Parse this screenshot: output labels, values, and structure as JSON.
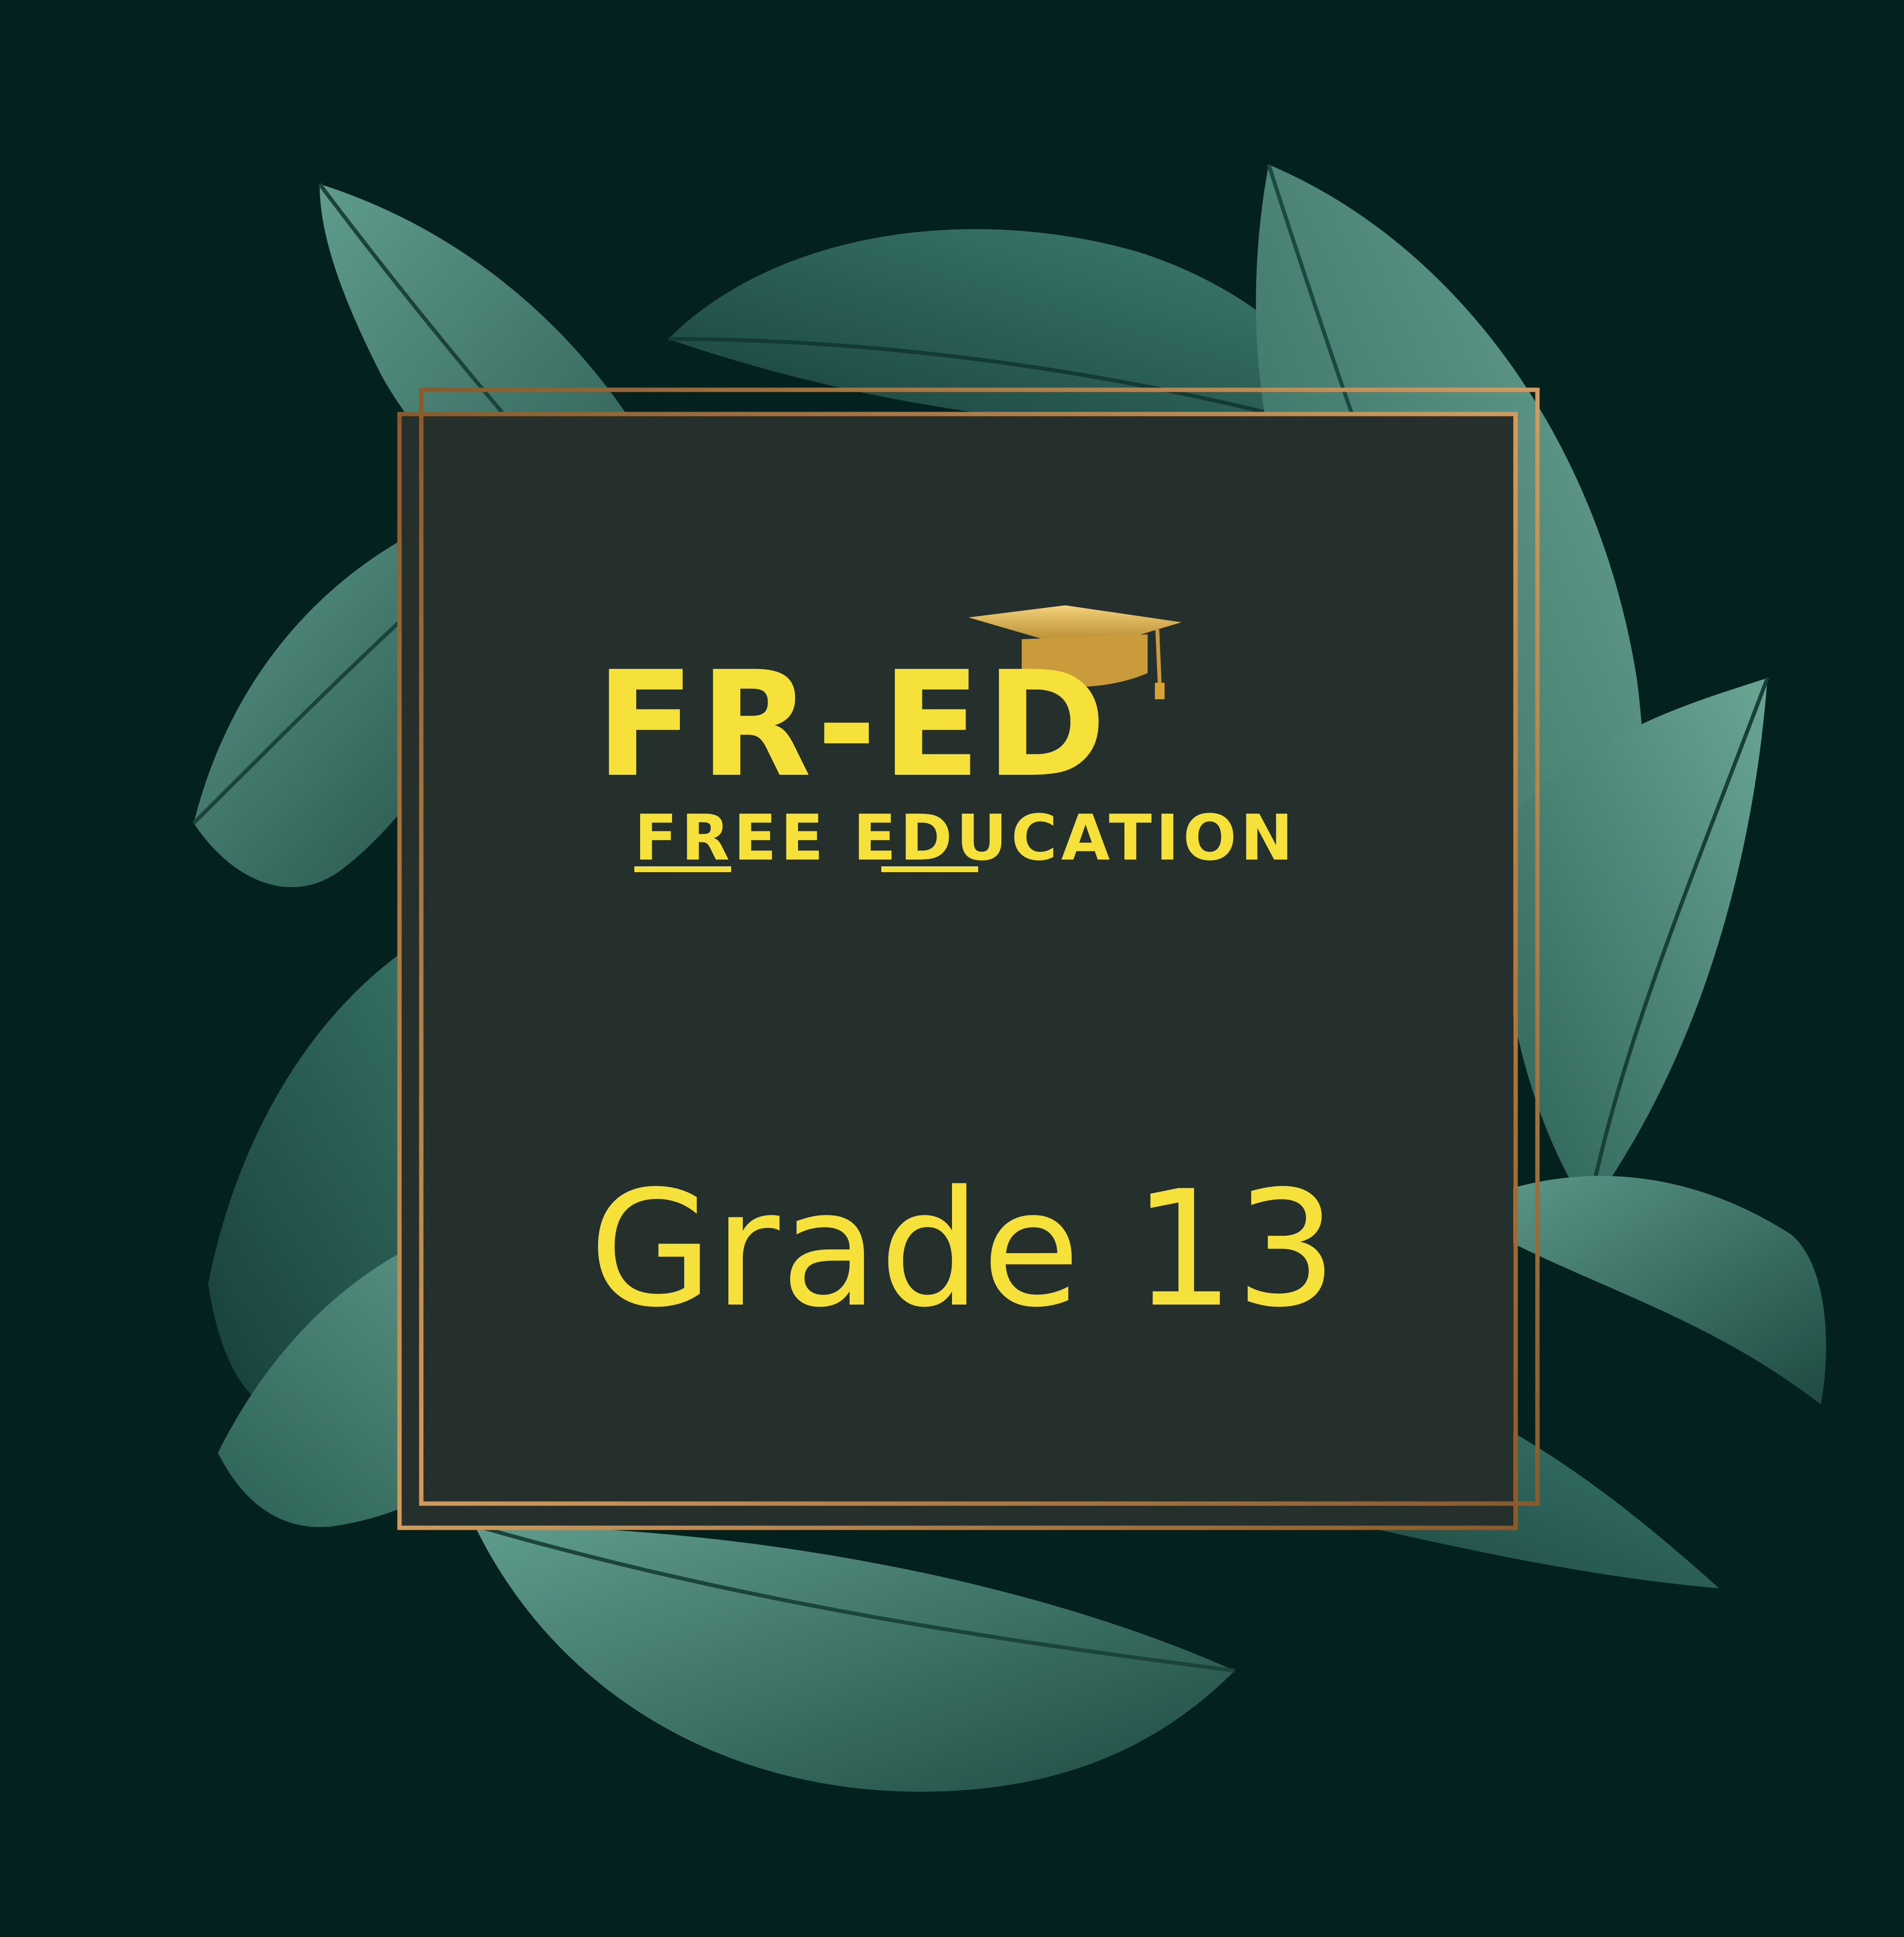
{
  "logo": {
    "main_text": "FR-ED",
    "sub_text": "FREE EDUCATION"
  },
  "grade_label": "Grade 13",
  "colors": {
    "background": "#03211e",
    "panel": "#25302c",
    "frame_gold": "#b07a44",
    "text_yellow": "#f5e13a",
    "leaf_light": "#4b8a7a",
    "leaf_dark": "#1f4f47",
    "cap_gold": "#d4a437"
  },
  "icons": [
    "graduation-cap-icon",
    "leaf-decoration"
  ]
}
